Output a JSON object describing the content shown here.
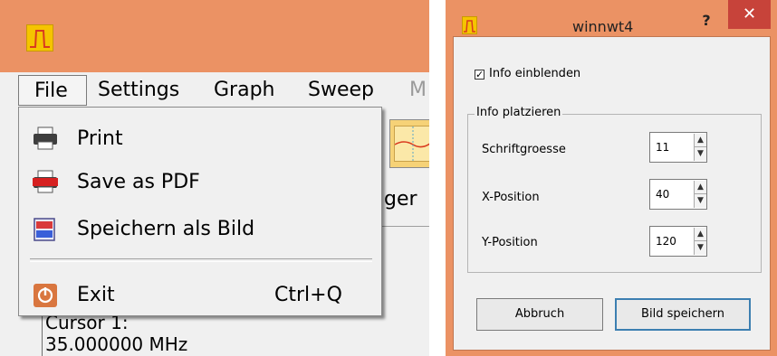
{
  "left_window": {
    "menu": {
      "file": "File",
      "settings": "Settings",
      "graph": "Graph",
      "sweep": "Sweep",
      "next_partial": "M"
    },
    "file_menu": {
      "items": [
        {
          "label": "Print",
          "icon": "printer-icon"
        },
        {
          "label": "Save as PDF",
          "icon": "pdf-icon"
        },
        {
          "label": "Speichern als Bild",
          "icon": "image-icon"
        },
        {
          "label": "Exit",
          "icon": "exit-icon",
          "shortcut": "Ctrl+Q"
        }
      ]
    },
    "background": {
      "partial_text": "ger",
      "cursor_label": "Cursor 1:",
      "cursor_value": "35.000000 MHz"
    }
  },
  "dialog": {
    "title": "winnwt4",
    "help_label": "?",
    "close_label": "✕",
    "checkbox": {
      "label": "Info einblenden",
      "checked": true
    },
    "group": {
      "title": "Info platzieren",
      "fields": [
        {
          "label": "Schriftgroesse",
          "value": "11"
        },
        {
          "label": "X-Position",
          "value": "40"
        },
        {
          "label": "Y-Position",
          "value": "120"
        }
      ]
    },
    "buttons": {
      "cancel": "Abbruch",
      "save": "Bild speichern"
    }
  },
  "colors": {
    "title_bar": "#eb9264",
    "close_button": "#c7433a",
    "app_icon": "#f5c400",
    "default_button_border": "#3c7fb1"
  }
}
